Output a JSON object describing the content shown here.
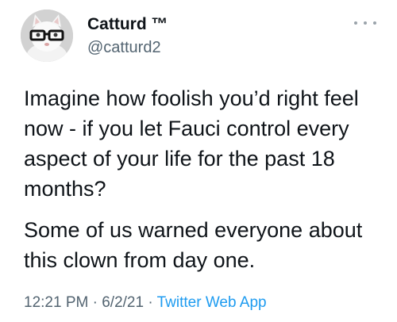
{
  "author": {
    "display_name": "Catturd ™",
    "handle": "@catturd2",
    "avatar_icon": "cat-with-glasses-avatar"
  },
  "menu": {
    "icon": "more-options-icon"
  },
  "tweet": {
    "paragraphs": [
      "Imagine how foolish you’d right feel now - if you let Fauci control every aspect of your life for the past 18 months?",
      "Some of us warned everyone about this clown from day one."
    ]
  },
  "meta": {
    "time": "12:21 PM",
    "separator": "·",
    "date": "6/2/21",
    "source": "Twitter Web App"
  },
  "colors": {
    "text": "#0f1419",
    "secondary": "#536471",
    "link": "#1d9bf0"
  }
}
